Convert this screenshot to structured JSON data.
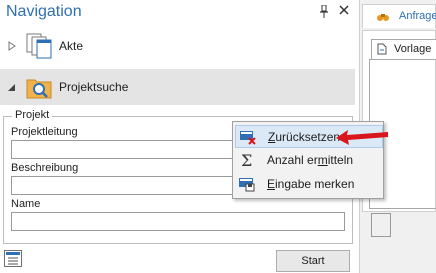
{
  "navigation": {
    "title": "Navigation",
    "tree": [
      {
        "label": "Akte",
        "icon": "document-stack-icon",
        "expanded": false
      },
      {
        "label": "Projektsuche",
        "icon": "folder-search-icon",
        "expanded": true
      }
    ]
  },
  "search_form": {
    "group_title": "Projekt",
    "fields": [
      {
        "label": "Projektleitung",
        "value": ""
      },
      {
        "label": "Beschreibung",
        "value": ""
      },
      {
        "label": "Name",
        "value": ""
      }
    ],
    "start_label": "Start"
  },
  "right_panel": {
    "tab_label": "Anfrage",
    "subtab_label": "Vorlage"
  },
  "context_menu": {
    "items": [
      {
        "pre": "",
        "accel": "Z",
        "post": "urücksetzen",
        "icon": "reset-icon",
        "highlighted": true
      },
      {
        "pre": "Anzahl er",
        "accel": "m",
        "post": "itteln",
        "icon": "sigma-icon",
        "highlighted": false
      },
      {
        "pre": "",
        "accel": "E",
        "post": "ingabe merken",
        "icon": "save-input-icon",
        "highlighted": false
      }
    ]
  },
  "colors": {
    "accent": "#2f6fb3",
    "selected_row": "#e4e4e4",
    "menu_highlight": "#dbe8f6",
    "annotation_arrow": "#d9161b"
  }
}
